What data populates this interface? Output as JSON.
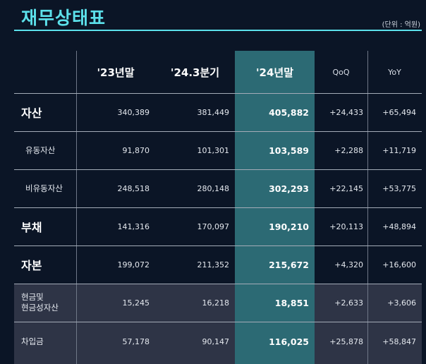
{
  "title": "재무상태표",
  "unit": "(단위 : 억원)",
  "colors": {
    "accent": "#5ce0ea",
    "highlight": "#2c6a74",
    "background": "#0b1526",
    "shaded": "#2e3446"
  },
  "headers": [
    "",
    "'23년말",
    "'24.3분기",
    "'24년말",
    "QoQ",
    "YoY"
  ],
  "rows": [
    {
      "label": "자산",
      "y23": "340,389",
      "q3_24": "381,449",
      "y24": "405,882",
      "qoq": "+24,433",
      "yoy": "+65,494"
    },
    {
      "label": "유동자산",
      "y23": "91,870",
      "q3_24": "101,301",
      "y24": "103,589",
      "qoq": "+2,288",
      "yoy": "+11,719"
    },
    {
      "label": "비유동자산",
      "y23": "248,518",
      "q3_24": "280,148",
      "y24": "302,293",
      "qoq": "+22,145",
      "yoy": "+53,775"
    },
    {
      "label": "부채",
      "y23": "141,316",
      "q3_24": "170,097",
      "y24": "190,210",
      "qoq": "+20,113",
      "yoy": "+48,894"
    },
    {
      "label": "자본",
      "y23": "199,072",
      "q3_24": "211,352",
      "y24": "215,672",
      "qoq": "+4,320",
      "yoy": "+16,600"
    },
    {
      "label1": "현금및",
      "label2": "현금성자산",
      "y23": "15,245",
      "q3_24": "16,218",
      "y24": "18,851",
      "qoq": "+2,633",
      "yoy": "+3,606"
    },
    {
      "label": "차입금",
      "y23": "57,178",
      "q3_24": "90,147",
      "y24": "116,025",
      "qoq": "+25,878",
      "yoy": "+58,847"
    }
  ]
}
